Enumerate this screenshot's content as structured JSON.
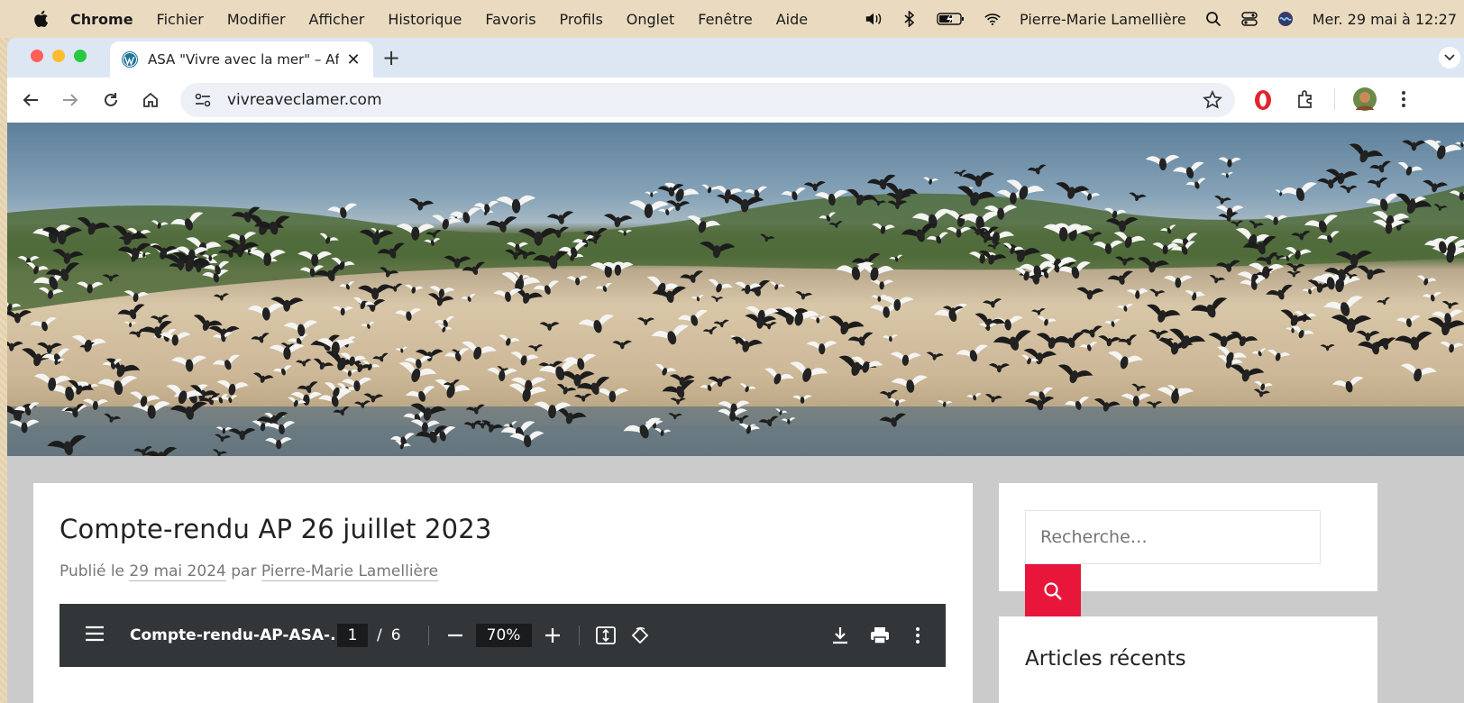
{
  "menubar": {
    "app": "Chrome",
    "items": [
      "Fichier",
      "Modifier",
      "Afficher",
      "Historique",
      "Favoris",
      "Profils",
      "Onglet",
      "Fenêtre",
      "Aide"
    ],
    "user": "Pierre-Marie Lamellière",
    "clock": "Mer. 29 mai à 12:27"
  },
  "browser": {
    "tab_title": "ASA \"Vivre avec la mer\" – Afi",
    "url": "vivreaveclamer.com"
  },
  "article": {
    "title": "Compte-rendu AP 26 juillet 2023",
    "meta_prefix": "Publié le",
    "date": "29 mai 2024",
    "meta_by": "par",
    "author": "Pierre-Marie Lamellière"
  },
  "pdf": {
    "filename": "Compte-rendu-AP-ASA-...",
    "current_page": "1",
    "separator": "/",
    "total_pages": "6",
    "zoom": "70%"
  },
  "sidebar": {
    "search_placeholder": "Recherche…",
    "recent_title": "Articles récents"
  },
  "colors": {
    "accent": "#e9163c",
    "pdf_toolbar": "#323639",
    "tab_strip": "#dde7f4"
  }
}
